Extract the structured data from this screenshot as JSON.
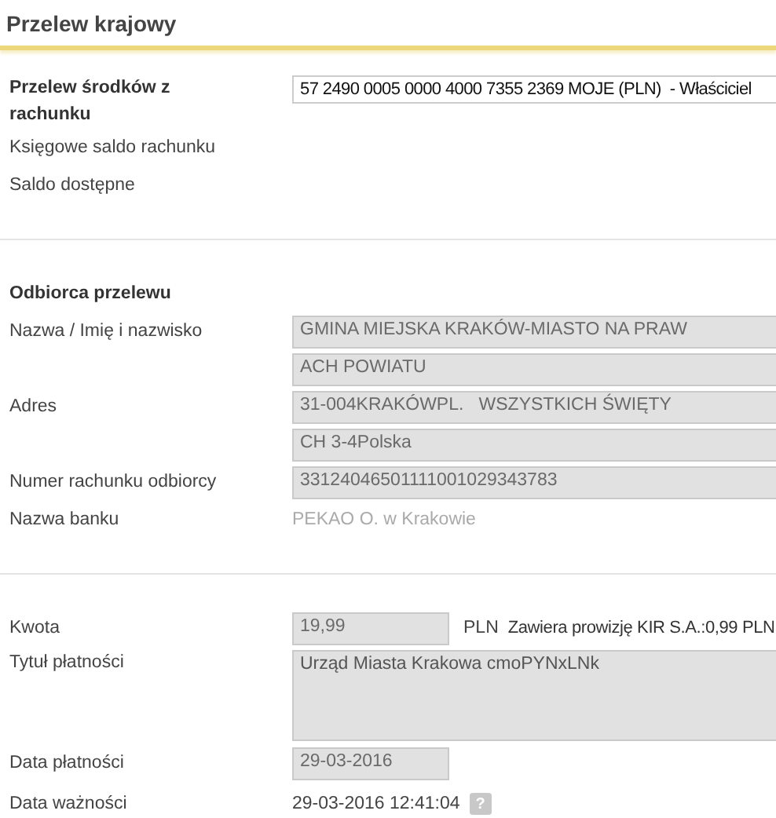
{
  "title": "Przelew krajowy",
  "source": {
    "label": "Przelew środków z rachunku",
    "account": "57 2490 0005 0000 4000 7355 2369 MOJE (PLN)  - Właściciel",
    "rows": [
      "Księgowe saldo rachunku",
      "Saldo dostępne"
    ]
  },
  "recipient": {
    "heading": "Odbiorca przelewu",
    "rows": [
      {
        "label": "Nazwa / Imię i nazwisko",
        "kind": "field",
        "lines": [
          "GMINA MIEJSKA KRAKÓW-MIASTO NA PRAW",
          "ACH POWIATU"
        ]
      },
      {
        "label": "Adres",
        "kind": "field",
        "lines": [
          "31-004KRAKÓWPL.   WSZYSTKICH ŚWIĘTY",
          "CH 3-4Polska"
        ]
      },
      {
        "label": "Numer rachunku odbiorcy",
        "kind": "field",
        "lines": [
          "33124046501111001029343783"
        ]
      },
      {
        "label": "Nazwa banku",
        "kind": "plain",
        "lines": [
          "PEKAO O. w Krakowie"
        ]
      }
    ]
  },
  "payment": {
    "amount": {
      "label": "Kwota",
      "value": "19,99",
      "currency": "PLN",
      "note": "Zawiera prowizję KIR S.A.:0,99 PLN"
    },
    "title": {
      "label": "Tytuł płatności",
      "value": "Urząd Miasta Krakowa cmoPYNxLNk"
    },
    "date": {
      "label": "Data płatności",
      "value": "29-03-2016"
    },
    "expiry": {
      "label": "Data ważności",
      "value": "29-03-2016 12:41:04",
      "help": "?"
    }
  }
}
